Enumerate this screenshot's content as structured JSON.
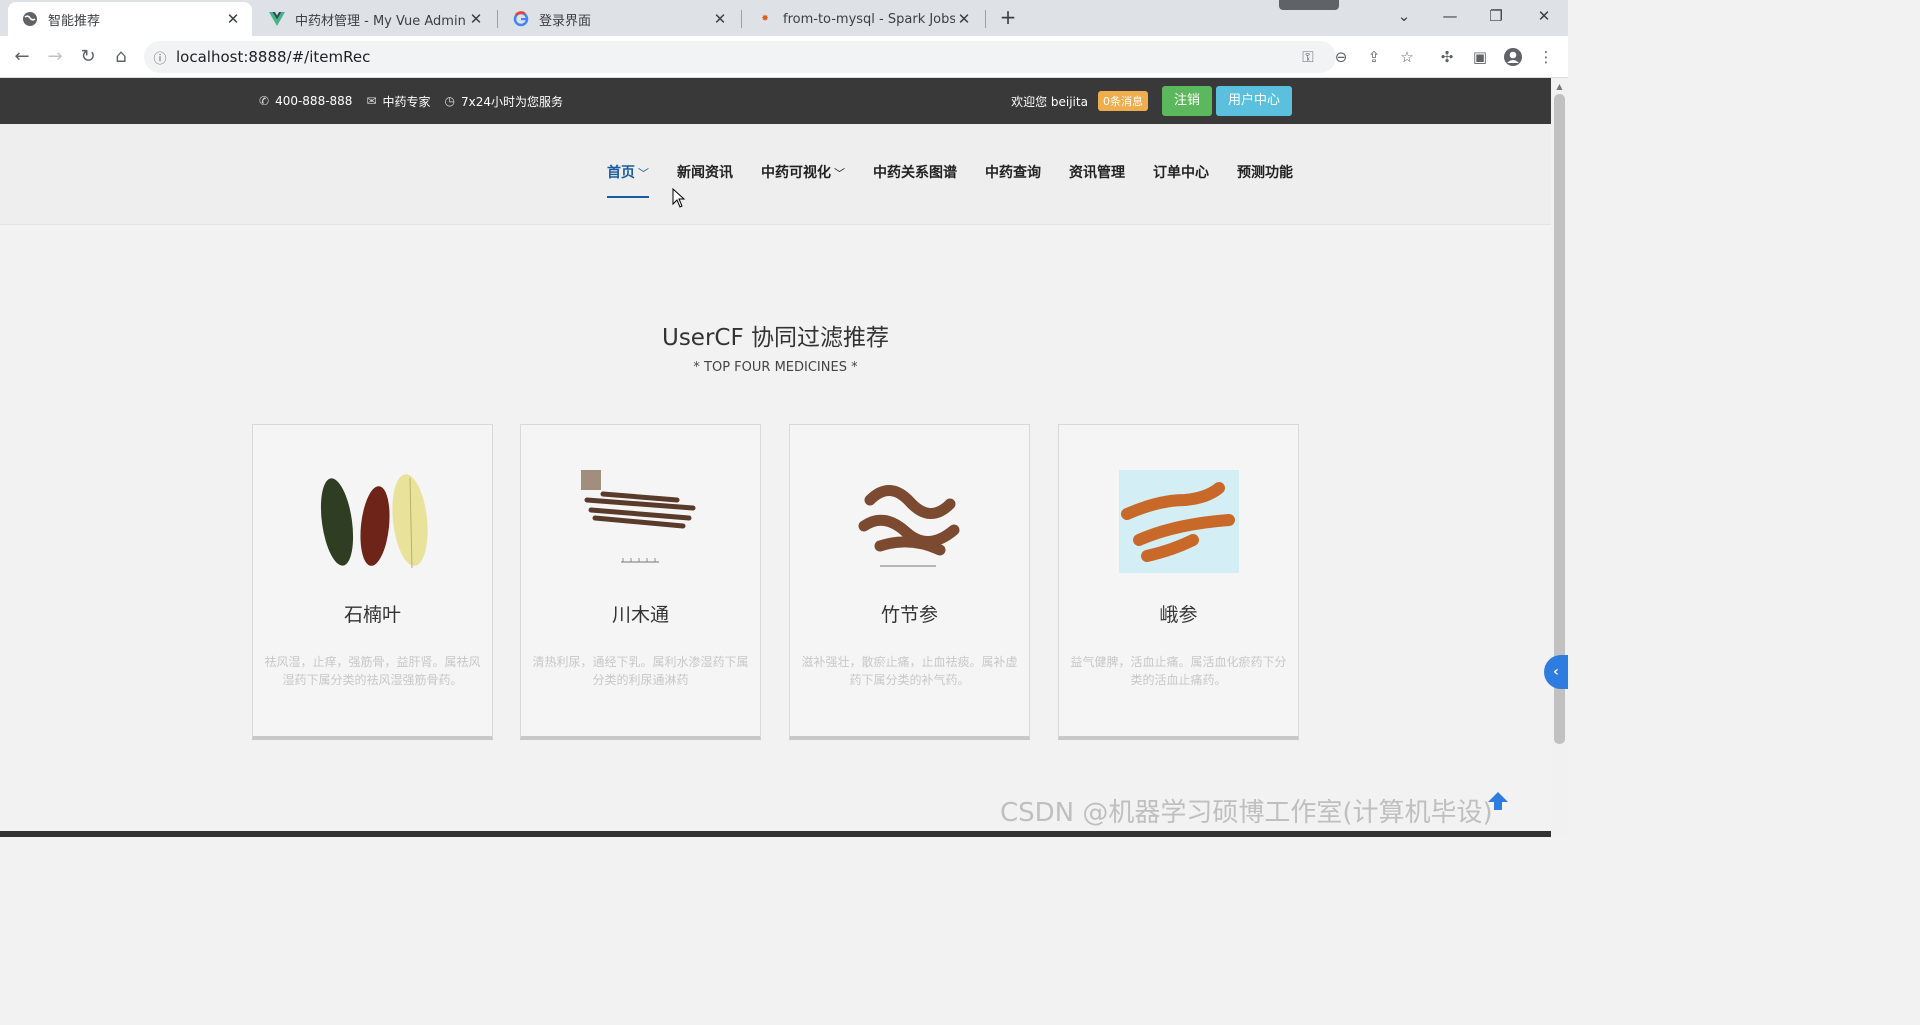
{
  "browser": {
    "tabs": [
      {
        "title": "智能推荐",
        "icon": "globe-icon",
        "active": true
      },
      {
        "title": "中药材管理 - My Vue Admin",
        "icon": "vue-logo-icon",
        "active": false
      },
      {
        "title": "登录界面",
        "icon": "google-logo-icon",
        "active": false
      },
      {
        "title": "from-to-mysql - Spark Jobs",
        "icon": "spark-logo-icon",
        "active": false
      }
    ],
    "url": "localhost:8888/#/itemRec"
  },
  "topbar": {
    "phone": "400-888-888",
    "expert": "中药专家",
    "service": "7x24小时为您服务",
    "welcome": "欢迎您 beijita",
    "messages_badge": "0条消息",
    "logout_label": "注销",
    "user_center_label": "用户中心"
  },
  "nav": {
    "items": [
      "首页",
      "新闻资讯",
      "中药可视化",
      "中药关系图谱",
      "中药查询",
      "资讯管理",
      "订单中心",
      "预测功能"
    ]
  },
  "section": {
    "title": "UserCF 协同过滤推荐",
    "subtitle": "* TOP FOUR MEDICINES *"
  },
  "cards": [
    {
      "name": "石楠叶",
      "desc": "祛风湿，止痒，强筋骨，益肝肾。属祛风湿药下属分类的祛风湿强筋骨药。"
    },
    {
      "name": "川木通",
      "desc": "清热利尿，通经下乳。属利水渗湿药下属分类的利尿通淋药"
    },
    {
      "name": "竹节参",
      "desc": "滋补强壮，散瘀止痛，止血祛痰。属补虚药下属分类的补气药。"
    },
    {
      "name": "峨参",
      "desc": "益气健脾，活血止痛。属活血化瘀药下分类的活血止痛药。"
    }
  ],
  "watermark": "CSDN @机器学习硕博工作室(计算机毕设)",
  "colors": {
    "nav_active": "#1b5c9e",
    "topbar_bg": "#393939",
    "badge": "#f0ad4e",
    "logout": "#5cb85c",
    "user_center": "#5bc0de"
  }
}
